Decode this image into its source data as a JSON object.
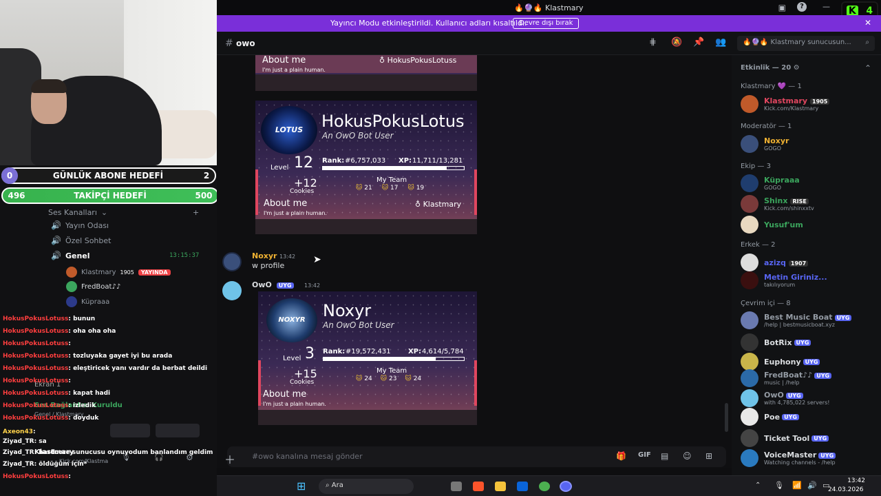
{
  "window": {
    "title": "Klastmary"
  },
  "banner": {
    "text": "Yayıncı Modu etkinleştirildi. Kullanıcı adları kısaltıldı.",
    "button": "Devre dışı bırak"
  },
  "channel": {
    "name": "owo",
    "search_placeholder": "Klastmary sunucusun..."
  },
  "goals": {
    "sub": {
      "start": "0",
      "title": "GÜNLÜK ABONE HEDEFİ",
      "target": "2"
    },
    "follow": {
      "current": "496",
      "title": "TAKİPÇİ HEDEFİ",
      "target": "500"
    }
  },
  "left": {
    "voice_header": "Ses Kanalları",
    "channels": [
      "Yayın Odası",
      "Özel Sohbet",
      "Genel"
    ],
    "genel_time": "13:15:37",
    "members": [
      {
        "name": "Klastmary",
        "badge": "1905",
        "live": "YAYINDA"
      },
      {
        "name": "FredBoat♪♪"
      },
      {
        "name": "Küpraaa"
      }
    ],
    "screen": "Ekran 1",
    "voice_connected": "Ses Bağlantısı Kuruldu",
    "voice_sub": "Genel / Klastmary",
    "user_name": "Klastmary",
    "user_sub": "Kick.com/Klastma"
  },
  "chat": [
    {
      "user": "HokusPokusLotuss",
      "msg": ": bunun"
    },
    {
      "user": "HokusPokusLotuss",
      "msg": ": oha oha oha"
    },
    {
      "user": "HokusPokusLotuss",
      "msg": ":"
    },
    {
      "user": "HokusPokusLotuss",
      "msg": ": tozluyaka gayet iyi bu arada"
    },
    {
      "user": "HokusPokusLotuss",
      "msg": ": eleştiricek yanı vardır da berbat deildi"
    },
    {
      "user": "HokusPokusLotuss",
      "msg": ":"
    },
    {
      "user": "HokusPokusLotuss",
      "msg": ": kapat hadi"
    },
    {
      "user": "HokusPokusLotuss",
      "msg": ": izledik"
    },
    {
      "user": "HokusPokusLotuss",
      "msg": ": doyduk"
    },
    {
      "user": "Axeon43",
      "msg": ":"
    },
    {
      "user": "Ziyad_TR",
      "msg": ": sa"
    },
    {
      "user": "Ziyad_TR",
      "msg": ": hardcore sunucusu oynuyodum banlandım geldim"
    },
    {
      "user": "Ziyad_TR",
      "msg": ": öldüğüm için*"
    },
    {
      "user": "HokusPokusLotuss",
      "msg": ":"
    }
  ],
  "messages": {
    "card1": {
      "about": "About me",
      "owner": "HokusPokusLotuss",
      "bio": "I'm just a plain human."
    },
    "card2": {
      "name": "HokusPokusLotus",
      "subtitle": "An OwO Bot User",
      "logo": "LOTUS",
      "level_label": "Level",
      "level": "12",
      "rank_label": "Rank:",
      "rank": "#6,757,033",
      "xp_label": "XP:",
      "xp": "11,711/13,281",
      "xp_fraction": 0.88,
      "cookies": "+12",
      "cookies_label": "Cookies",
      "team_label": "My Team",
      "team": [
        "21",
        "17",
        "19"
      ],
      "about": "About me",
      "owner": "Klastmary",
      "bio": "I'm just a plain human."
    },
    "noxyr": {
      "name": "Noxyr",
      "time": "13:42",
      "text": "w profile"
    },
    "owo": {
      "name": "OwO",
      "tag": "UYG",
      "time": "13:42"
    },
    "card3": {
      "name": "Noxyr",
      "subtitle": "An OwO Bot User",
      "logo": "NOXYR",
      "level_label": "Level",
      "level": "3",
      "rank_label": "Rank:",
      "rank": "#19,572,431",
      "xp_label": "XP:",
      "xp": "4,614/5,784",
      "xp_fraction": 0.8,
      "cookies": "+15",
      "cookies_label": "Cookies",
      "team_label": "My Team",
      "team": [
        "24",
        "23",
        "24"
      ],
      "about": "About me",
      "bio": "I'm just a plain human."
    }
  },
  "composer": {
    "placeholder": "#owo kanalına mesaj gönder"
  },
  "member_list": {
    "activity": "Etkinlik — 20",
    "sections": [
      {
        "title": "Klastmary 💜 — 1",
        "members": [
          {
            "name": "Klastmary",
            "badge": "1905",
            "sub": "Kick.com/Klastmary",
            "color": "#e0465f"
          }
        ]
      },
      {
        "title": "Moderatör — 1",
        "members": [
          {
            "name": "Noxyr",
            "sub": "GOGO",
            "color": "#f0b232"
          }
        ]
      },
      {
        "title": "Ekip — 3",
        "members": [
          {
            "name": "Küpraaa",
            "sub": "GOGO",
            "color": "#3ba55d"
          },
          {
            "name": "Shinx",
            "badge": "RISE",
            "sub": "Kick.com/shinxxtv",
            "color": "#3ba55d"
          },
          {
            "name": "Yusuf'um",
            "sub": "",
            "color": "#3ba55d"
          }
        ]
      },
      {
        "title": "Erkek — 2",
        "members": [
          {
            "name": "azizq",
            "badge": "1907",
            "sub": "",
            "color": "#5865f2"
          },
          {
            "name": "Metin Giriniz...",
            "sub": "takılıyorum",
            "color": "#5865f2"
          }
        ]
      },
      {
        "title": "Çevrim içi — 8",
        "members": [
          {
            "name": "Best Music Boat",
            "tag": "UYG",
            "sub": "/help | bestmusicboat.xyz",
            "color": "#949ba4"
          },
          {
            "name": "BotRix",
            "tag": "UYG",
            "sub": "",
            "color": "#dbdee1"
          },
          {
            "name": "Euphony",
            "tag": "UYG",
            "sub": "",
            "color": "#dbdee1"
          },
          {
            "name": "FredBoat♪♪",
            "tag": "UYG",
            "sub": "music | /help",
            "color": "#949ba4"
          },
          {
            "name": "OwO",
            "tag": "UYG",
            "sub": "with 4,785,022 servers!",
            "color": "#949ba4"
          },
          {
            "name": "Poe",
            "tag": "UYG",
            "sub": "",
            "color": "#dbdee1"
          },
          {
            "name": "Ticket Tool",
            "tag": "UYG",
            "sub": "",
            "color": "#dbdee1"
          },
          {
            "name": "VoiceMaster",
            "tag": "UYG",
            "sub": "Watching channels - /help",
            "color": "#dbdee1"
          }
        ]
      }
    ]
  },
  "taskbar": {
    "search": "Ara",
    "time": "13:42",
    "date": "24.03.2026"
  },
  "kick_badge": "4"
}
